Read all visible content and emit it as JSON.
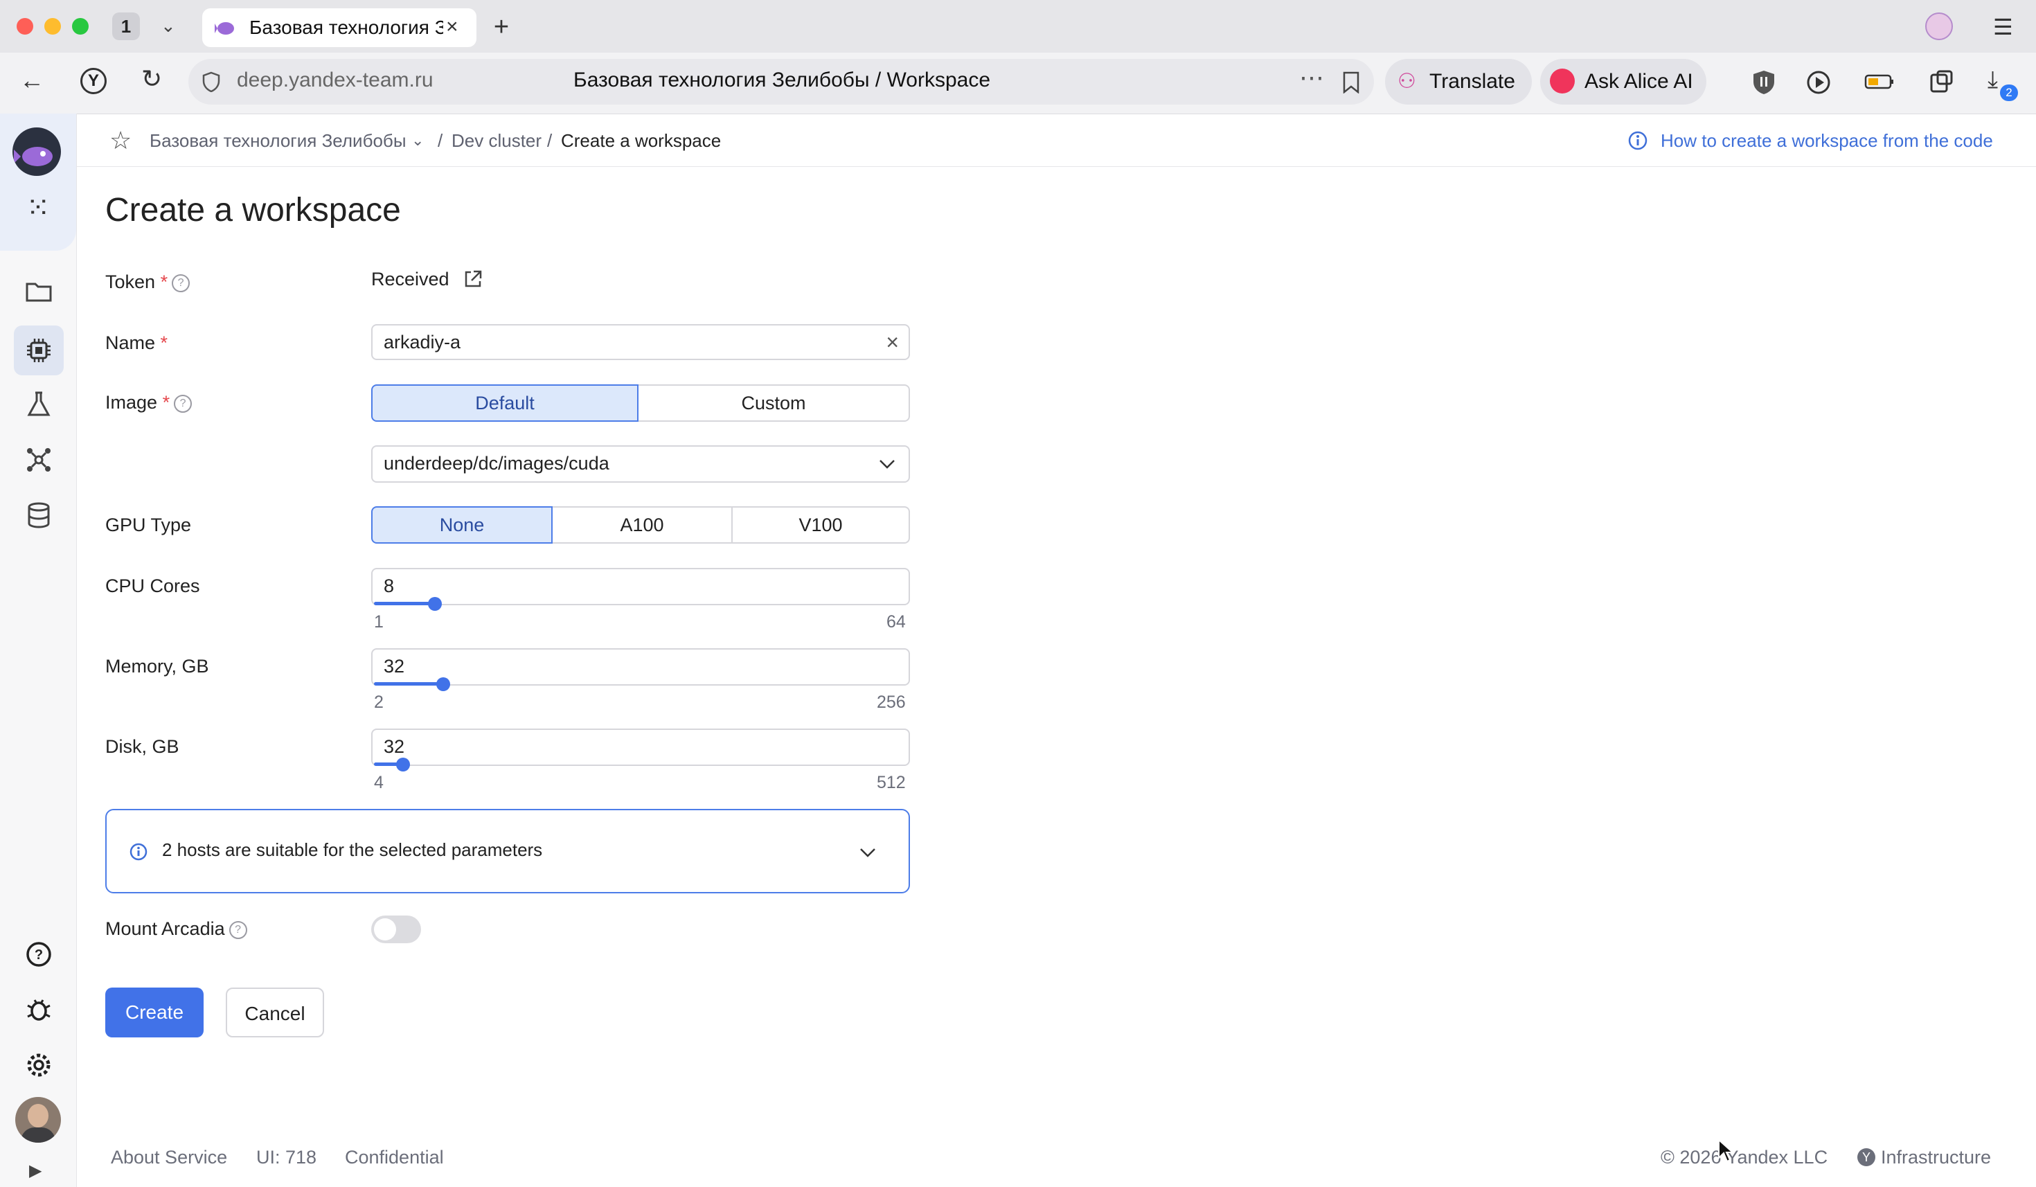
{
  "browser": {
    "tab_count": "1",
    "tab_title": "Базовая технология Зе",
    "url": "deep.yandex-team.ru",
    "page_title": "Базовая технология Зелибобы / Workspace",
    "translate_label": "Translate",
    "alice_label": "Ask Alice AI",
    "downloads_badge": "2"
  },
  "breadcrumb": {
    "project": "Базовая технология Зелибобы",
    "sep1": "/",
    "cluster": "Dev cluster",
    "sep2": "/",
    "current": "Create a workspace",
    "help_link": "How to create a workspace from the code"
  },
  "page": {
    "title": "Create a workspace"
  },
  "form": {
    "token": {
      "label": "Token",
      "required": "*",
      "value": "Received"
    },
    "name": {
      "label": "Name",
      "required": "*",
      "value": "arkadiy-a"
    },
    "image": {
      "label": "Image",
      "required": "*",
      "options": [
        "Default",
        "Custom"
      ],
      "selected": "Default",
      "path": "underdeep/dc/images/cuda"
    },
    "gpu": {
      "label": "GPU Type",
      "options": [
        "None",
        "A100",
        "V100"
      ],
      "selected": "None"
    },
    "cpu": {
      "label": "CPU Cores",
      "value": "8",
      "min": "1",
      "max": "64"
    },
    "memory": {
      "label": "Memory, GB",
      "value": "32",
      "min": "2",
      "max": "256"
    },
    "disk": {
      "label": "Disk, GB",
      "value": "32",
      "min": "4",
      "max": "512"
    },
    "hosts_info": "2 hosts are suitable for the selected parameters",
    "mount": {
      "label": "Mount Arcadia",
      "enabled": false
    },
    "create_label": "Create",
    "cancel_label": "Cancel"
  },
  "footer": {
    "about": "About Service",
    "ui_version": "UI: 718",
    "confidential": "Confidential",
    "copyright": "© 2026 Yandex LLC",
    "infrastructure": "Infrastructure"
  },
  "colors": {
    "accent": "#4172e8",
    "required": "#e5484d",
    "selected_bg": "#dce8fb"
  }
}
